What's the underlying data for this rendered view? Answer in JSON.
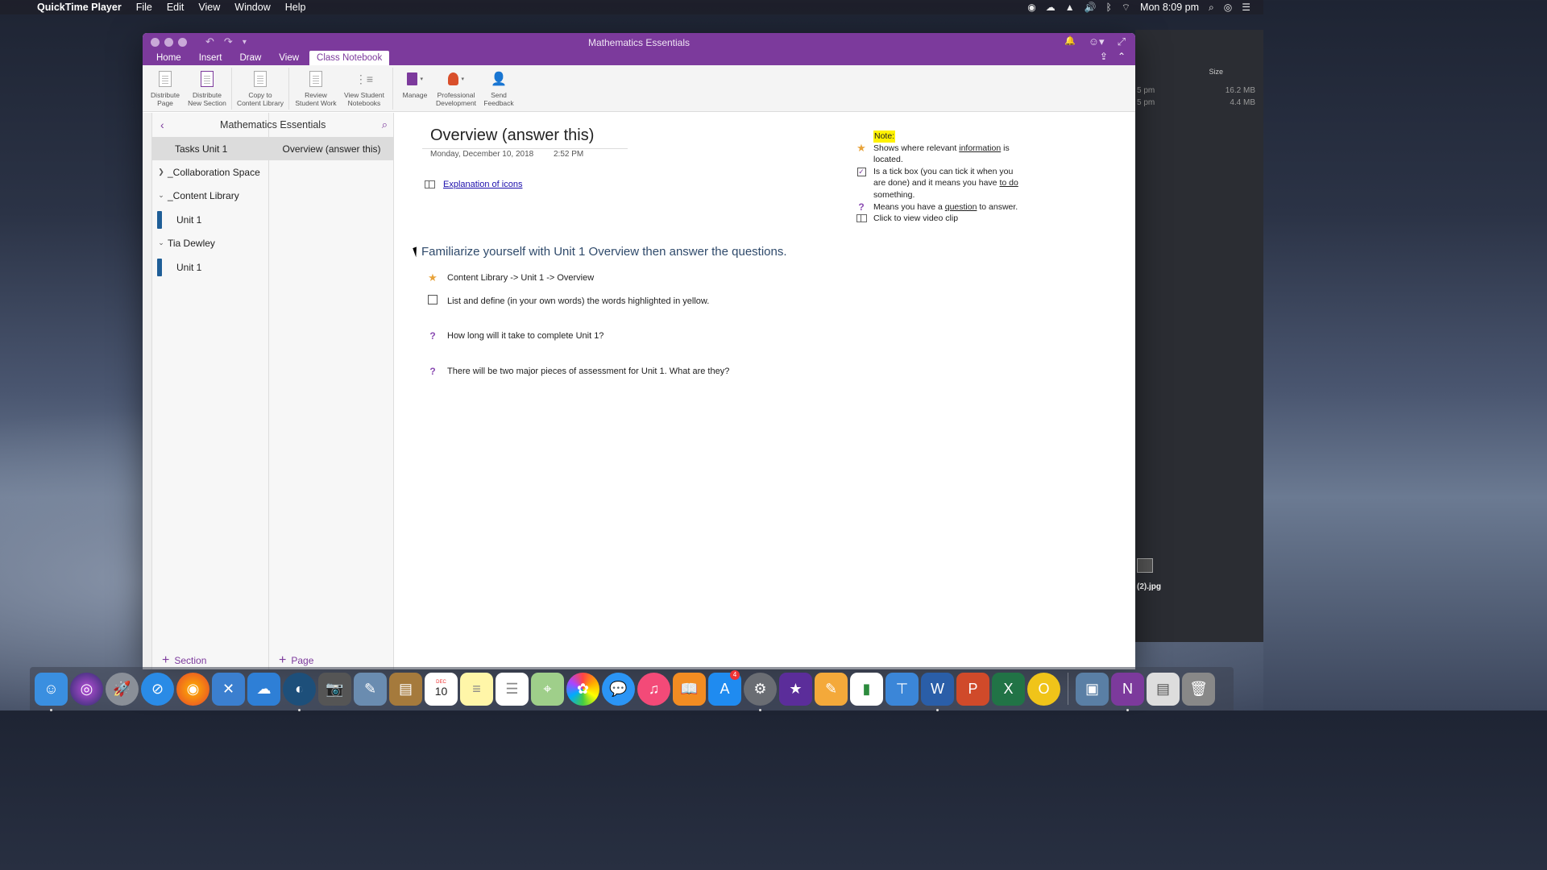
{
  "menubar": {
    "app_name": "QuickTime Player",
    "menus": [
      "File",
      "Edit",
      "View",
      "Window",
      "Help"
    ],
    "clock": "Mon 8:09 pm"
  },
  "window": {
    "title": "Mathematics Essentials",
    "tabs": [
      {
        "label": "Home"
      },
      {
        "label": "Insert"
      },
      {
        "label": "Draw"
      },
      {
        "label": "View"
      },
      {
        "label": "Class Notebook",
        "active": true
      }
    ]
  },
  "ribbon": {
    "buttons": [
      {
        "label": "Distribute\nPage"
      },
      {
        "label": "Distribute\nNew Section"
      },
      {
        "label": "Copy to\nContent Library"
      },
      {
        "label": "Review\nStudent Work"
      },
      {
        "label": "View Student\nNotebooks"
      },
      {
        "label": "Manage"
      },
      {
        "label": "Professional\nDevelopment"
      },
      {
        "label": "Send\nFeedback"
      }
    ]
  },
  "navigation": {
    "notebook_title": "Mathematics Essentials",
    "sections": [
      {
        "label": "Tasks Unit 1",
        "active": true,
        "level": 0
      },
      {
        "label": "_Collaboration Space",
        "level": 0,
        "chevron": "right"
      },
      {
        "label": "_Content Library",
        "level": 0,
        "chevron": "down"
      },
      {
        "label": "Unit 1",
        "level": 1
      },
      {
        "label": "Tia Dewley",
        "level": 0,
        "chevron": "down"
      },
      {
        "label": "Unit 1",
        "level": 1
      }
    ],
    "pages": [
      {
        "label": "Overview (answer this)",
        "active": true
      }
    ],
    "add_section_label": "Section",
    "add_page_label": "Page"
  },
  "page": {
    "title": "Overview (answer this)",
    "date": "Monday, December 10, 2018",
    "time": "2:52 PM",
    "link_text": "Explanation of icons",
    "heading": "Familiarize yourself with Unit 1 Overview then answer the questions.",
    "tasks": [
      {
        "icon": "star-icon",
        "text": "Content Library -> Unit 1 -> Overview"
      },
      {
        "icon": "checkbox-icon",
        "text": "List and define (in your own words) the words highlighted in yellow."
      },
      {
        "icon": "question-icon",
        "text": "How long will it take to complete Unit 1?"
      },
      {
        "icon": "question-icon",
        "text": "There will be two major pieces of assessment for Unit 1. What are they?"
      }
    ],
    "note": {
      "title": "Note:",
      "star_pre": "Shows where relevant ",
      "star_link": "information",
      "star_post": " is located.",
      "tick_pre": "Is a tick box (you can tick it when you are done) and it means you have ",
      "tick_link": "to do",
      "tick_post": " something.",
      "q_pre": "Means you have a ",
      "q_link": "question",
      "q_post": " to answer.",
      "video": "Click to view video clip"
    }
  },
  "finder": {
    "size_header": "Size",
    "rows": [
      {
        "time": "5 pm",
        "size": "16.2 MB"
      },
      {
        "time": "5 pm",
        "size": "4.4 MB"
      }
    ],
    "file_label": "(2).jpg"
  },
  "dock": {
    "apps": [
      "Finder",
      "Siri",
      "Launchpad",
      "Safari",
      "Firefox",
      "Xcode",
      "iCloud",
      "Edge",
      "Screenshot",
      "Preview",
      "Notes Book",
      "Calendar",
      "Notes",
      "Reminders",
      "Maps",
      "Photos",
      "Messages",
      "iTunes",
      "Books",
      "App Store",
      "System Preferences",
      "iMovie",
      "Pages",
      "Numbers",
      "Keynote",
      "Word",
      "PowerPoint",
      "Excel",
      "Outlook",
      "Image Capture",
      "OneNote",
      "Documents",
      "Trash"
    ],
    "calendar_day": "10",
    "app_store_badge": "4"
  }
}
